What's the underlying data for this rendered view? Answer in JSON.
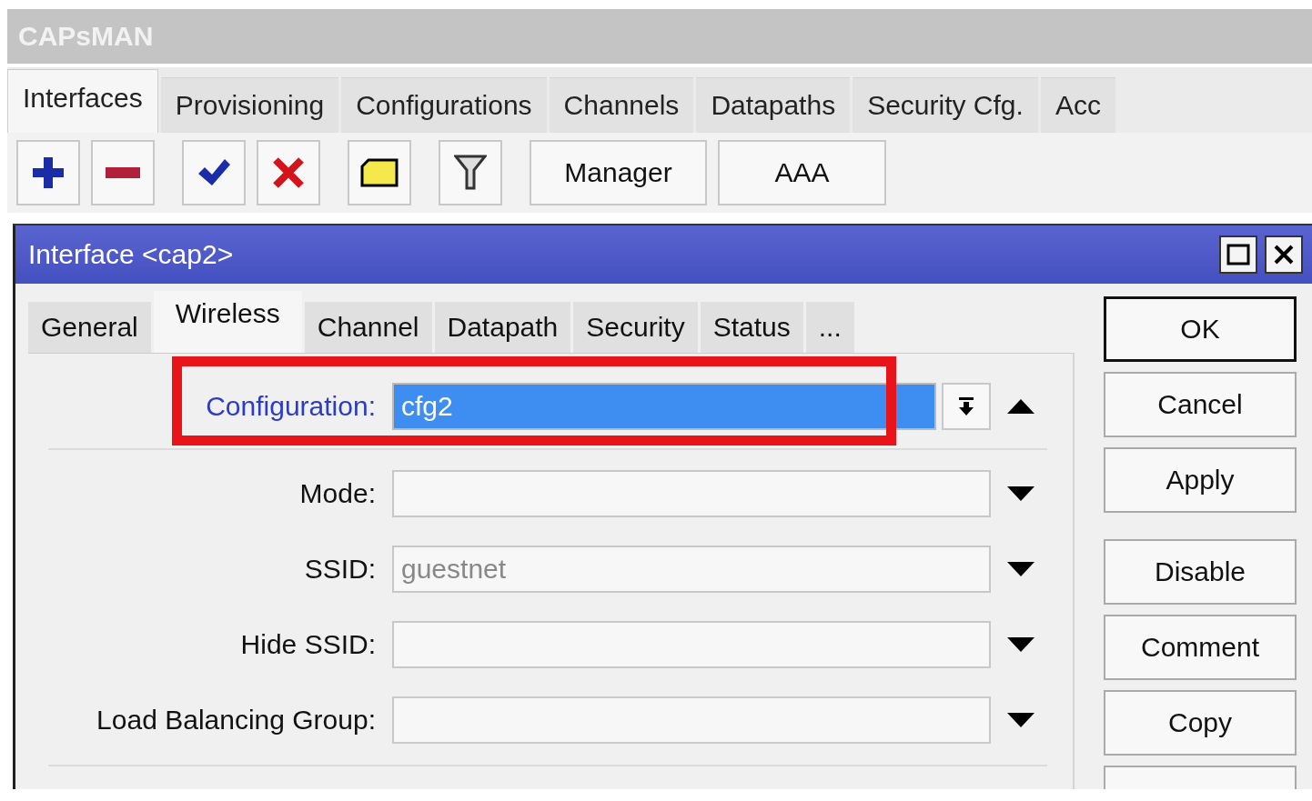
{
  "window": {
    "title": "CAPsMAN"
  },
  "tabs": [
    {
      "label": "Interfaces",
      "selected": true
    },
    {
      "label": "Provisioning",
      "selected": false
    },
    {
      "label": "Configurations",
      "selected": false
    },
    {
      "label": "Channels",
      "selected": false
    },
    {
      "label": "Datapaths",
      "selected": false
    },
    {
      "label": "Security Cfg.",
      "selected": false
    },
    {
      "label": "Acc",
      "selected": false
    }
  ],
  "toolbar": {
    "icons": [
      {
        "kind": "add"
      },
      {
        "kind": "remove"
      },
      {
        "kind": "enable"
      },
      {
        "kind": "disable"
      },
      {
        "kind": "comment"
      },
      {
        "kind": "filter"
      }
    ],
    "buttons": [
      "Manager",
      "AAA"
    ]
  },
  "dialog": {
    "title": "Interface <cap2>",
    "tabs": [
      {
        "label": "General",
        "selected": false
      },
      {
        "label": "Wireless",
        "selected": true
      },
      {
        "label": "Channel",
        "selected": false
      },
      {
        "label": "Datapath",
        "selected": false
      },
      {
        "label": "Security",
        "selected": false
      },
      {
        "label": "Status",
        "selected": false
      },
      {
        "label": "...",
        "selected": false
      }
    ],
    "fields": [
      {
        "kind": "select",
        "label": "Configuration:",
        "value": "cfg2",
        "selected": true,
        "highlighted": true
      },
      {
        "kind": "optional",
        "label": "Mode:",
        "selected": false,
        "highlighted": false
      },
      {
        "kind": "optional",
        "label": "SSID:",
        "placeholder": "guestnet",
        "selected": false,
        "highlighted": false
      },
      {
        "kind": "optional",
        "label": "Hide SSID:",
        "selected": false,
        "highlighted": false
      },
      {
        "kind": "optional",
        "label": "Load Balancing Group:",
        "selected": false,
        "highlighted": false
      }
    ],
    "buttons": [
      {
        "label": "OK",
        "default": true
      },
      {
        "label": "Cancel",
        "default": false
      },
      {
        "label": "Apply",
        "default": false
      },
      {
        "label": "Disable",
        "default": false
      },
      {
        "label": "Comment",
        "default": false
      },
      {
        "label": "Copy",
        "default": false
      }
    ]
  }
}
